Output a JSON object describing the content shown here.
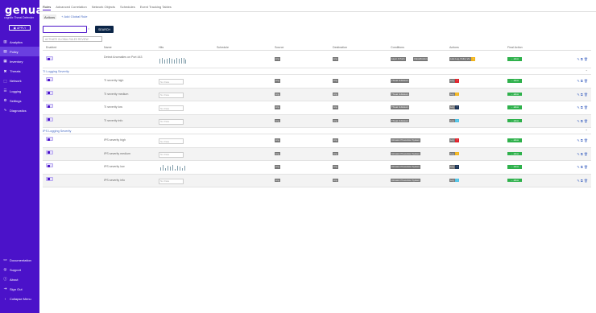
{
  "app": {
    "logo": "genua.",
    "subtitle": "cognitix Threat Defender",
    "apply_label": "APPLY"
  },
  "sidebar": {
    "items": [
      {
        "label": "Analytics",
        "icon": "chart-icon"
      },
      {
        "label": "Policy",
        "icon": "policy-icon",
        "active": true
      },
      {
        "label": "Inventory",
        "icon": "inventory-icon"
      },
      {
        "label": "Threats",
        "icon": "threats-icon"
      },
      {
        "label": "Network",
        "icon": "network-icon"
      },
      {
        "label": "Logging",
        "icon": "logging-icon"
      },
      {
        "label": "Settings",
        "icon": "gear-icon"
      },
      {
        "label": "Diagnostics",
        "icon": "diagnostics-icon"
      }
    ],
    "bottom": [
      {
        "label": "Documentation",
        "icon": "book-icon"
      },
      {
        "label": "Support",
        "icon": "support-icon"
      },
      {
        "label": "About",
        "icon": "info-icon"
      },
      {
        "label": "Sign Out",
        "icon": "signout-icon"
      },
      {
        "label": "Collapse Menu",
        "icon": "collapse-icon"
      }
    ]
  },
  "tabs": [
    "Rules",
    "Advanced Correlation",
    "Network Objects",
    "Schedules",
    "Event Tracking Tables"
  ],
  "subtabs": {
    "actions": "Actions",
    "add": "+ Add Global Rule"
  },
  "search": {
    "value": "",
    "clear": "×",
    "button": "SEARCH"
  },
  "global_rules_button": "ACTIVATE GLOBAL RULES REVIEW",
  "columns": [
    "Enabled",
    "Name",
    "Hits",
    "Schedule",
    "Source",
    "Destination",
    "Conditions",
    "Actions",
    "Final Action"
  ],
  "rows_top": [
    {
      "name": "Detect Anomalies on Port 443",
      "hits": "spark",
      "source": "Any",
      "destination": "Any",
      "conditions": [
        "Layer 4 Ports",
        "Classification"
      ],
      "actions": [
        "Late Log, Policy Vio"
      ],
      "sev": "yellow",
      "final": "→ allow"
    }
  ],
  "sections": [
    {
      "title": "TI Logging Severity",
      "rows": [
        {
          "name": "TI severity high",
          "hits_placeholder": "No Data",
          "source": "Any",
          "destination": "Any",
          "condition": "Threat Indicators",
          "action": "Log",
          "sev": "red",
          "final": "→ allow"
        },
        {
          "name": "TI severity medium",
          "hits_placeholder": "No Data",
          "source": "Any",
          "destination": "Any",
          "condition": "Threat Indicators",
          "action": "Log",
          "sev": "yellow",
          "final": "→ allow"
        },
        {
          "name": "TI severity low",
          "hits_placeholder": "No Data",
          "source": "Any",
          "destination": "Any",
          "condition": "Threat Indicators",
          "action": "Log",
          "sev": "navy",
          "final": "→ allow"
        },
        {
          "name": "TI severity info",
          "hits_placeholder": "No Data",
          "source": "Any",
          "destination": "Any",
          "condition": "Threat Indicators",
          "action": "Log",
          "sev": "cyan",
          "final": "→ allow"
        }
      ]
    },
    {
      "title": "IPS Logging Severity",
      "rows": [
        {
          "name": "IPS severity high",
          "hits_placeholder": "No Data",
          "source": "Any",
          "destination": "Any",
          "condition": "Intrusion Prevention System",
          "action": "Log",
          "sev": "red",
          "final": "→ allow"
        },
        {
          "name": "IPS severity medium",
          "hits_placeholder": "No Data",
          "source": "Any",
          "destination": "Any",
          "condition": "Intrusion Prevention System",
          "action": "Log",
          "sev": "yellow",
          "final": "→ allow"
        },
        {
          "name": "IPS severity low",
          "hits_placeholder": "",
          "source": "Any",
          "destination": "Any",
          "condition": "Intrusion Prevention System",
          "action": "Log",
          "sev": "navy",
          "final": "→ allow",
          "spark": true
        },
        {
          "name": "IPS severity info",
          "hits_placeholder": "No Data",
          "source": "Any",
          "destination": "Any",
          "condition": "Intrusion Prevention System",
          "action": "Log",
          "sev": "cyan",
          "final": "→ allow"
        }
      ]
    }
  ],
  "colors": {
    "brand": "#4b12c9",
    "allow": "#2fb14c",
    "red": "#e0242d",
    "yellow": "#f2b51d",
    "navy": "#1d3557",
    "cyan": "#4ec3e6"
  }
}
